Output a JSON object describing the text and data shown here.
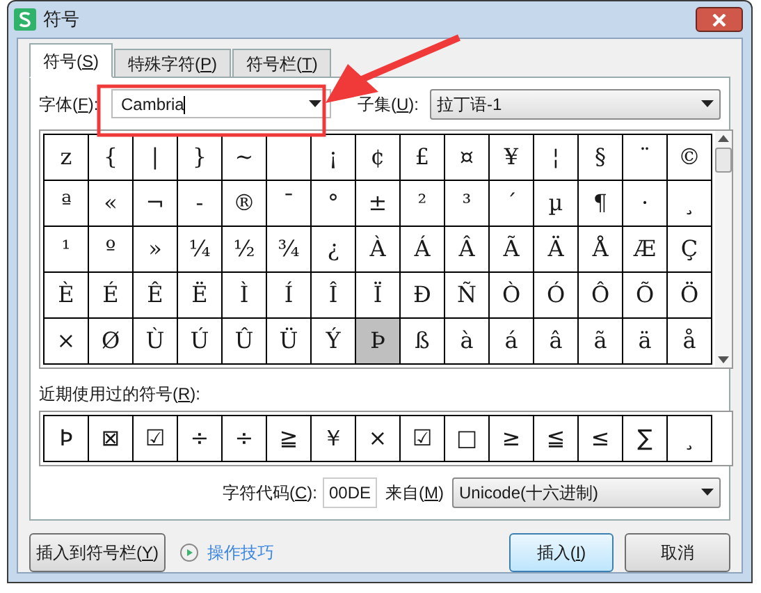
{
  "window": {
    "title": "符号"
  },
  "tabs": [
    {
      "before": "符号(",
      "key": "S",
      "after": ")",
      "selected": true
    },
    {
      "before": "特殊字符(",
      "key": "P",
      "after": ")",
      "selected": false
    },
    {
      "before": "符号栏(",
      "key": "T",
      "after": ")",
      "selected": false
    }
  ],
  "font": {
    "label": {
      "before": "字体(",
      "key": "F",
      "after": "):"
    },
    "value": "Cambria"
  },
  "subset": {
    "label": {
      "before": "子集(",
      "key": "U",
      "after": "):"
    },
    "value": "拉丁语-1"
  },
  "symbols": [
    [
      {
        "char": "z",
        "selected": false
      },
      {
        "char": "{",
        "selected": false
      },
      {
        "char": "|",
        "selected": false
      },
      {
        "char": "}",
        "selected": false
      },
      {
        "char": "~",
        "selected": false
      },
      {
        "selected": false
      },
      {
        "char": "¡",
        "selected": false
      },
      {
        "char": "¢",
        "selected": false
      },
      {
        "char": "£",
        "selected": false
      },
      {
        "char": "¤",
        "selected": false
      },
      {
        "char": "¥",
        "selected": false
      },
      {
        "char": "¦",
        "selected": false
      },
      {
        "char": "§",
        "selected": false
      },
      {
        "char": "¨",
        "selected": false
      },
      {
        "char": "©",
        "selected": false
      }
    ],
    [
      {
        "char": "ª",
        "selected": false
      },
      {
        "char": "«",
        "selected": false
      },
      {
        "char": "¬",
        "selected": false
      },
      {
        "char": "-",
        "selected": false
      },
      {
        "char": "®",
        "selected": false
      },
      {
        "char": "¯",
        "selected": false
      },
      {
        "char": "°",
        "selected": false
      },
      {
        "char": "±",
        "selected": false
      },
      {
        "char": "²",
        "selected": false
      },
      {
        "char": "³",
        "selected": false
      },
      {
        "char": "´",
        "selected": false
      },
      {
        "char": "µ",
        "selected": false
      },
      {
        "char": "¶",
        "selected": false
      },
      {
        "char": "·",
        "selected": false
      },
      {
        "char": "¸",
        "selected": false
      }
    ],
    [
      {
        "char": "¹",
        "selected": false
      },
      {
        "char": "º",
        "selected": false
      },
      {
        "char": "»",
        "selected": false
      },
      {
        "char": "¼",
        "selected": false
      },
      {
        "char": "½",
        "selected": false
      },
      {
        "char": "¾",
        "selected": false
      },
      {
        "char": "¿",
        "selected": false
      },
      {
        "char": "À",
        "selected": false
      },
      {
        "char": "Á",
        "selected": false
      },
      {
        "char": "Â",
        "selected": false
      },
      {
        "char": "Ã",
        "selected": false
      },
      {
        "char": "Ä",
        "selected": false
      },
      {
        "char": "Å",
        "selected": false
      },
      {
        "char": "Æ",
        "selected": false
      },
      {
        "char": "Ç",
        "selected": false
      }
    ],
    [
      {
        "char": "È",
        "selected": false
      },
      {
        "char": "É",
        "selected": false
      },
      {
        "char": "Ê",
        "selected": false
      },
      {
        "char": "Ë",
        "selected": false
      },
      {
        "char": "Ì",
        "selected": false
      },
      {
        "char": "Í",
        "selected": false
      },
      {
        "char": "Î",
        "selected": false
      },
      {
        "char": "Ï",
        "selected": false
      },
      {
        "char": "Ð",
        "selected": false
      },
      {
        "char": "Ñ",
        "selected": false
      },
      {
        "char": "Ò",
        "selected": false
      },
      {
        "char": "Ó",
        "selected": false
      },
      {
        "char": "Ô",
        "selected": false
      },
      {
        "char": "Õ",
        "selected": false
      },
      {
        "char": "Ö",
        "selected": false
      }
    ],
    [
      {
        "char": "×",
        "selected": false
      },
      {
        "char": "Ø",
        "selected": false
      },
      {
        "char": "Ù",
        "selected": false
      },
      {
        "char": "Ú",
        "selected": false
      },
      {
        "char": "Û",
        "selected": false
      },
      {
        "char": "Ü",
        "selected": false
      },
      {
        "char": "Ý",
        "selected": false
      },
      {
        "char": "Þ",
        "selected": true
      },
      {
        "char": "ß",
        "selected": false
      },
      {
        "char": "à",
        "selected": false
      },
      {
        "char": "á",
        "selected": false
      },
      {
        "char": "â",
        "selected": false
      },
      {
        "char": "ã",
        "selected": false
      },
      {
        "char": "ä",
        "selected": false
      },
      {
        "char": "å",
        "selected": false
      }
    ]
  ],
  "recent": {
    "label": {
      "before": "近期使用过的符号(",
      "key": "R",
      "after": "):"
    },
    "symbols": [
      "Þ",
      "⊠",
      "☑",
      "÷",
      "÷",
      "≧",
      "￥",
      "×",
      "☑",
      "□",
      "≥",
      "≦",
      "≤",
      "∑",
      "¸"
    ]
  },
  "char_code": {
    "label": {
      "before": "字符代码(",
      "key": "C",
      "after": "):"
    },
    "value": "00DE"
  },
  "from": {
    "label": {
      "before": "来自(",
      "key": "M",
      "after": ")"
    },
    "value": "Unicode(十六进制)"
  },
  "buttons": {
    "insert_to_bar": {
      "before": "插入到符号栏(",
      "key": "Y",
      "after": ")"
    },
    "tips_link": "操作技巧",
    "insert": {
      "before": "插入(",
      "key": "I",
      "after": ")"
    },
    "cancel": "取消"
  }
}
